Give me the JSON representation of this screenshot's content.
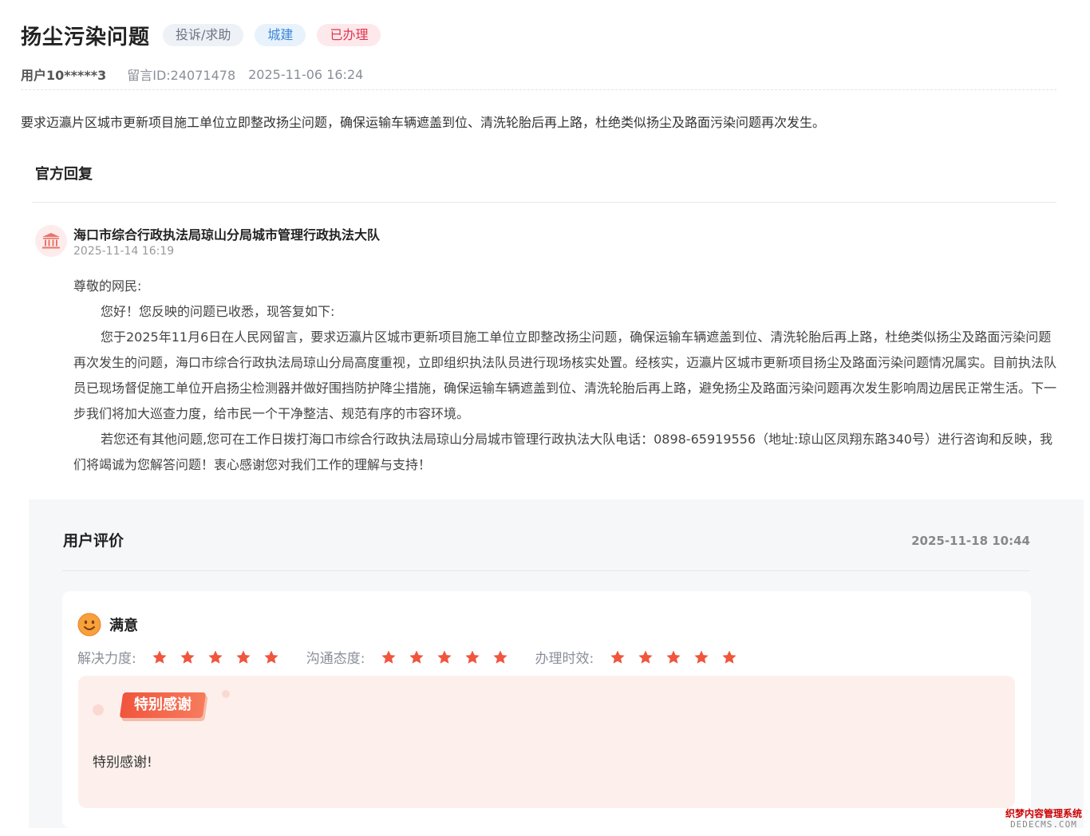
{
  "header": {
    "title": "扬尘污染问题",
    "tags": {
      "type": "投诉/求助",
      "category": "城建",
      "status": "已办理"
    },
    "meta": {
      "user": "用户10*****3",
      "message_id": "留言ID:24071478",
      "time": "2025-11-06 16:24"
    }
  },
  "content": "要求迈瀛片区城市更新项目施工单位立即整改扬尘问题，确保运输车辆遮盖到位、清洗轮胎后再上路，杜绝类似扬尘及路面污染问题再次发生。",
  "official_reply": {
    "section_title": "官方回复",
    "org_icon": "government-building-icon",
    "org_name": "海口市综合行政执法局琼山分局城市管理行政执法大队",
    "time": "2025-11-14 16:19",
    "paragraphs": [
      "尊敬的网民:",
      "您好！您反映的问题已收悉，现答复如下:",
      "您于2025年11月6日在人民网留言，要求迈瀛片区城市更新项目施工单位立即整改扬尘问题，确保运输车辆遮盖到位、清洗轮胎后再上路，杜绝类似扬尘及路面污染问题再次发生的问题，海口市综合行政执法局琼山分局高度重视，立即组织执法队员进行现场核实处置。经核实，迈瀛片区城市更新项目扬尘及路面污染问题情况属实。目前执法队员已现场督促施工单位开启扬尘检测器并做好围挡防护降尘措施，确保运输车辆遮盖到位、清洗轮胎后再上路，避免扬尘及路面污染问题再次发生影响周边居民正常生活。下一步我们将加大巡查力度，给市民一个干净整洁、规范有序的市容环境。",
      "若您还有其他问题,您可在工作日拨打海口市综合行政执法局琼山分局城市管理行政执法大队电话：0898-65919556（地址:琼山区凤翔东路340号）进行咨询和反映，我们将竭诚为您解答问题！衷心感谢您对我们工作的理解与支持！"
    ]
  },
  "evaluation": {
    "section_title": "用户评价",
    "time": "2025-11-18 10:44",
    "satisfaction_icon": "smiley-face-icon",
    "satisfaction": "满意",
    "ratings": [
      {
        "label": "解决力度:",
        "stars": 5,
        "max": 5
      },
      {
        "label": "沟通态度:",
        "stars": 5,
        "max": 5
      },
      {
        "label": "办理时效:",
        "stars": 5,
        "max": 5
      }
    ],
    "star_color": "#f0553d",
    "badge": "特别感谢",
    "comment": "特别感谢!"
  },
  "watermark": {
    "line1": "织梦内容管理系统",
    "line2": "DEDECMS.COM"
  }
}
